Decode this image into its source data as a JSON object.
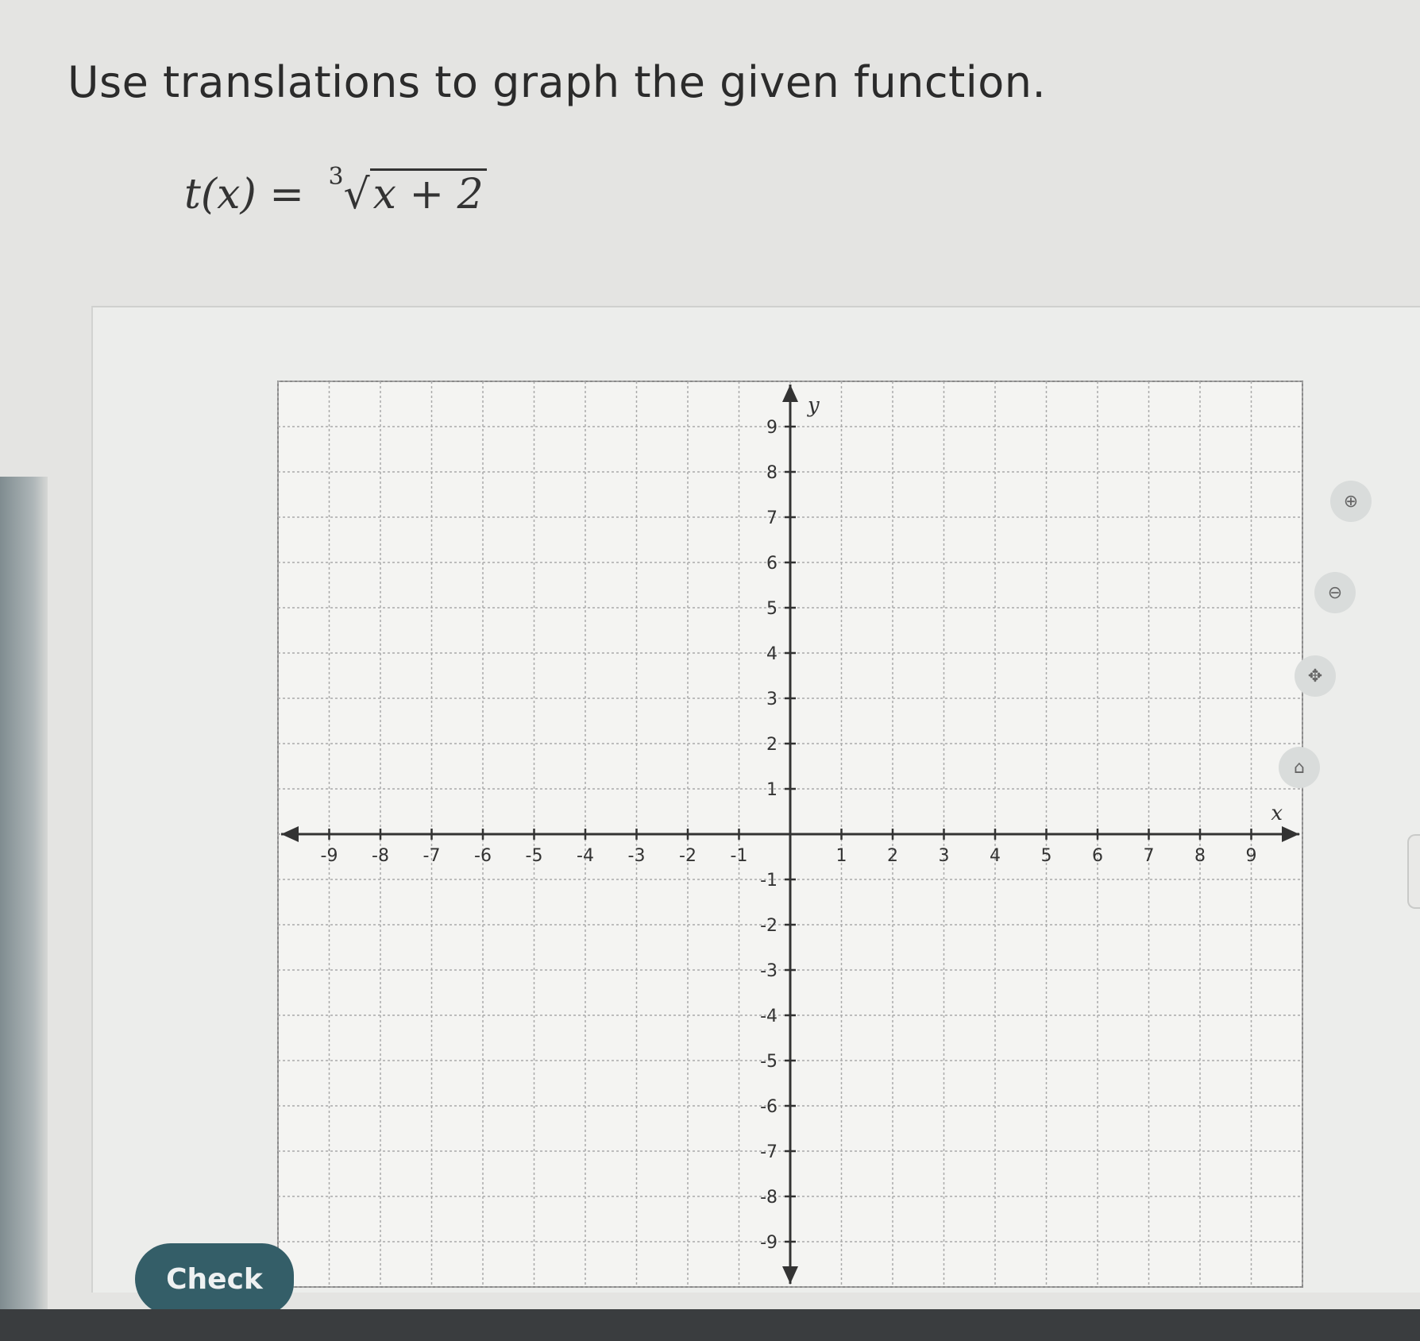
{
  "question": "Use translations to graph the given function.",
  "formula": {
    "lhs": "t(x) = ",
    "index": "3",
    "radical": "√",
    "radicand": "x + 2"
  },
  "graph": {
    "x_axis_label": "x",
    "y_axis_label": "y",
    "x_tick_labels": [
      "-9",
      "-8",
      "-7",
      "-6",
      "-5",
      "-4",
      "-3",
      "-2",
      "-1",
      "1",
      "2",
      "3",
      "4",
      "5",
      "6",
      "7",
      "8",
      "9"
    ],
    "y_tick_labels": [
      "9",
      "8",
      "7",
      "6",
      "5",
      "4",
      "3",
      "2",
      "1",
      "-1",
      "-2",
      "-3",
      "-4",
      "-5",
      "-6",
      "-7",
      "-8",
      "-9"
    ],
    "x_range": [
      -10,
      10
    ],
    "y_range": [
      -10,
      10
    ],
    "grid": true
  },
  "tools": {
    "zoom_in_icon": "magnifier-plus-icon",
    "zoom_out_icon": "magnifier-minus-icon",
    "pan_icon": "move-arrows-icon",
    "home_icon": "home-icon"
  },
  "check_button_label": "Check"
}
